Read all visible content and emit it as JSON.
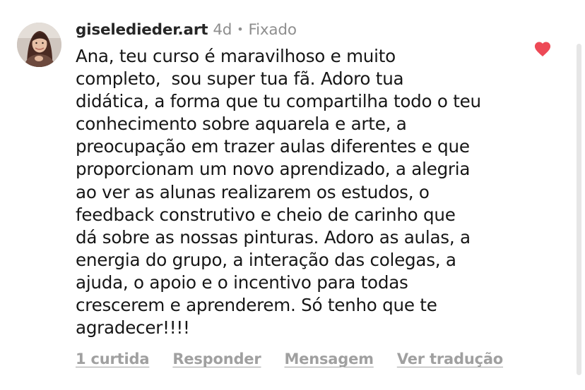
{
  "comment": {
    "username": "giseledieder.art",
    "time_ago": "4d",
    "separator": "•",
    "pinned_label": "Fixado",
    "liked": true,
    "heart_color": "#ed4956",
    "body_lines": [
      "Ana, teu curso é maravilhoso e muito",
      "completo,  sou super tua fã. Adoro tua",
      "didática, a forma que tu compartilha todo o teu",
      "conhecimento sobre aquarela e arte, a",
      "preocupação em trazer aulas diferentes e que",
      "proporcionam um novo aprendizado, a alegria",
      "ao ver as alunas realizarem os estudos, o",
      "feedback construtivo e cheio de carinho que",
      "dá sobre as nossas pinturas. Adoro as aulas, a",
      "energia do grupo, a interação das colegas, a",
      "ajuda, o apoio e o incentivo para todas",
      "crescerem e aprenderem. Só tenho que te",
      "agradecer!!!!"
    ],
    "actions": {
      "likes": "1 curtida",
      "reply": "Responder",
      "message": "Mensagem",
      "translate": "Ver tradução"
    }
  },
  "icons": {
    "avatar": "avatar-photo",
    "like": "heart-icon"
  }
}
